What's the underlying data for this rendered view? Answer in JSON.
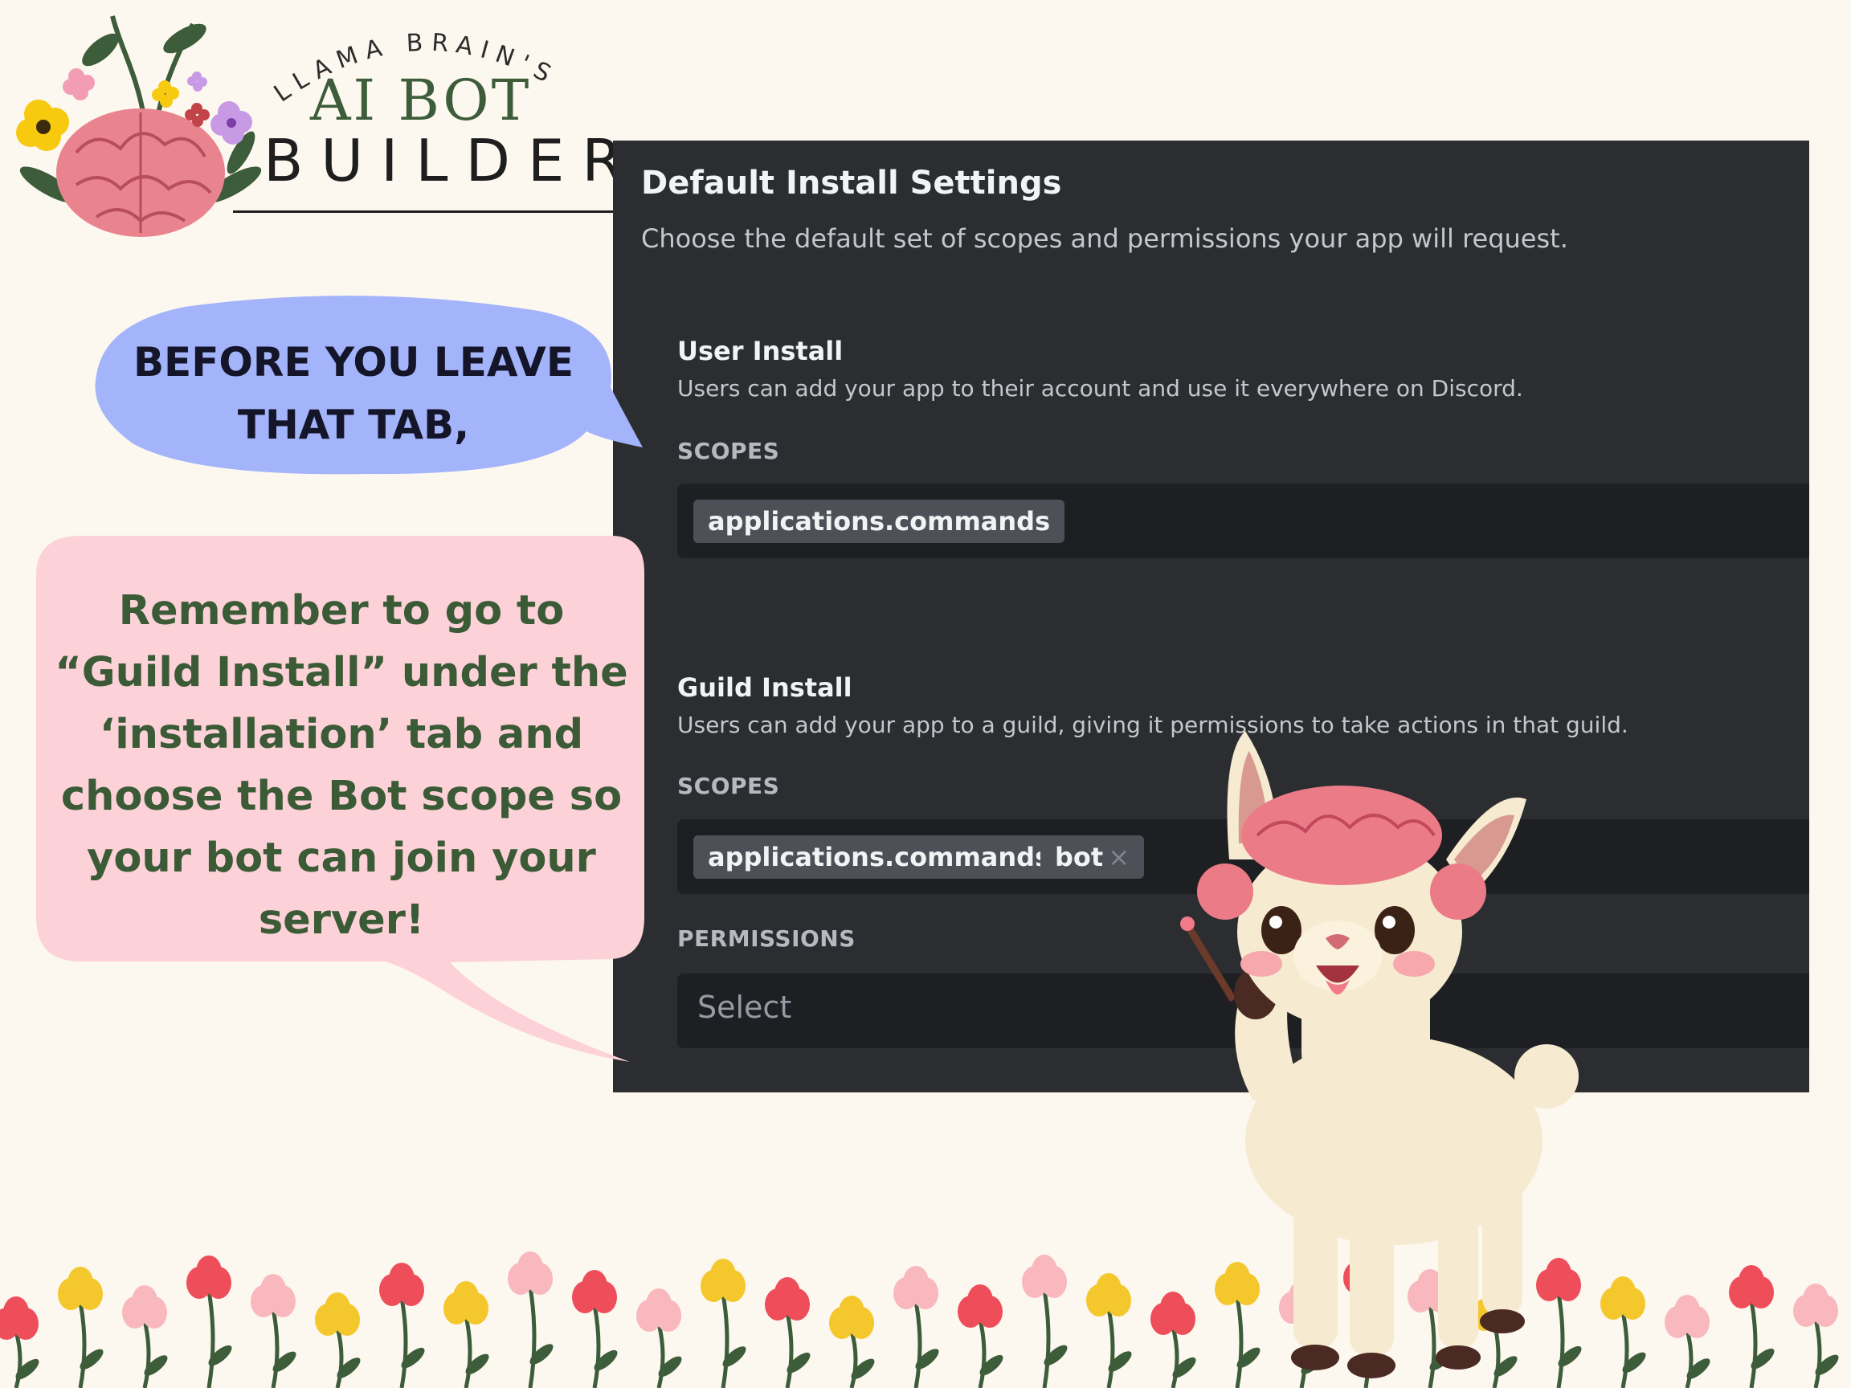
{
  "logo": {
    "top_text": "LLAMA BRAIN'S",
    "mid_text": "AI BOT",
    "bottom_text": "BUILDER"
  },
  "panel": {
    "title": "Default Install Settings",
    "description": "Choose the default set of scopes and permissions your app will request.",
    "user_install": {
      "title": "User Install",
      "description": "Users can add your app to their account and use it everywhere on Discord.",
      "scopes_label": "SCOPES",
      "scopes": [
        "applications.commands"
      ]
    },
    "guild_install": {
      "title": "Guild Install",
      "description": "Users can add your app to a guild, giving it permissions to take actions in that guild.",
      "scopes_label": "SCOPES",
      "scopes": [
        "applications.commands",
        "bot"
      ],
      "remove_glyph": "×",
      "permissions_label": "PERMISSIONS",
      "permissions_placeholder": "Select"
    }
  },
  "bubbles": {
    "blue_line1": "BEFORE YOU LEAVE",
    "blue_line2": "THAT TAB,",
    "pink_lines": [
      "Remember to go to",
      "“Guild Install” under the",
      "‘installation’ tab and",
      "choose the Bot scope so",
      "your bot can join your",
      "server!"
    ]
  },
  "colors": {
    "background": "#fcf7ef",
    "panel": "#2b2d31",
    "field": "#1e1f22",
    "chip": "#4e5058",
    "blue_bubble": "#a3b4fb",
    "pink_bubble": "#fcd2d8",
    "pink_text": "#3b5a36"
  }
}
